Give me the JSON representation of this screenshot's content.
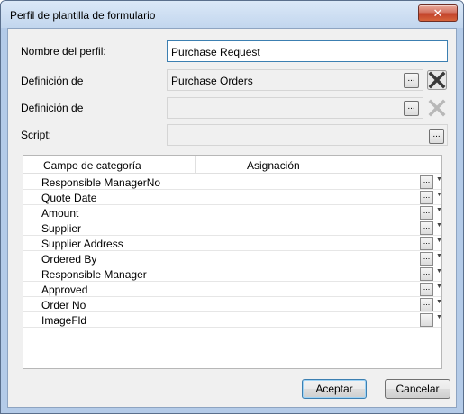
{
  "window": {
    "title": "Perfil de plantilla de formulario",
    "close_symbol": "✕"
  },
  "form": {
    "profile_name_label": "Nombre del perfil:",
    "profile_name_value": "Purchase Request",
    "definition1_label": "Definición de",
    "definition1_value": "Purchase Orders",
    "definition2_label": "Definición de",
    "definition2_value": "",
    "script_label": "Script:",
    "script_value": "",
    "ellipsis": "..."
  },
  "grid": {
    "columns": [
      "Campo de categoría",
      "Asignación"
    ],
    "rows": [
      "Responsible ManagerNo",
      "Quote Date",
      "Amount",
      "Supplier",
      "Supplier Address",
      "Ordered By",
      "Responsible Manager",
      "Approved",
      "Order No",
      "ImageFld"
    ],
    "dropdown_symbol": "▼"
  },
  "buttons": {
    "ok_label": "Aceptar",
    "cancel_label": "Cancelar"
  },
  "icons": {
    "clear_active": "clear-x-icon",
    "clear_disabled": "clear-x-disabled-icon"
  }
}
